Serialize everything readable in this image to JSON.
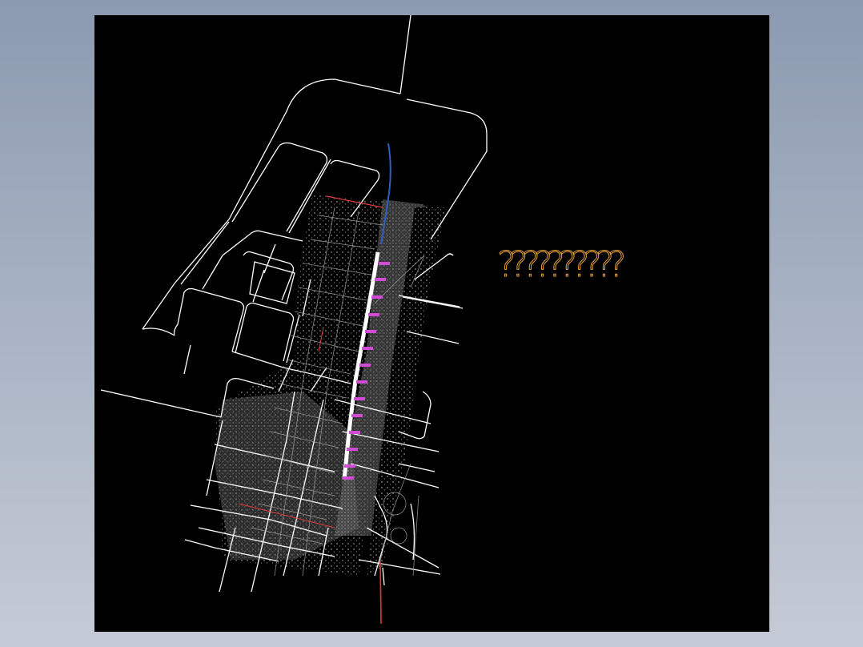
{
  "drawing": {
    "placeholder_text": "??????????",
    "colors": {
      "background": "#000000",
      "outline": "#ffffff",
      "detail": "#9a9a9a",
      "route_main": "#ffffff",
      "route_north": "#2f5fbf",
      "route_south": "#e03a3a",
      "boundary": "#e03a3a",
      "station_label": "#d24bd6",
      "placeholder": "#e8a23a"
    },
    "icons": [
      "cad-drawing-canvas"
    ]
  }
}
